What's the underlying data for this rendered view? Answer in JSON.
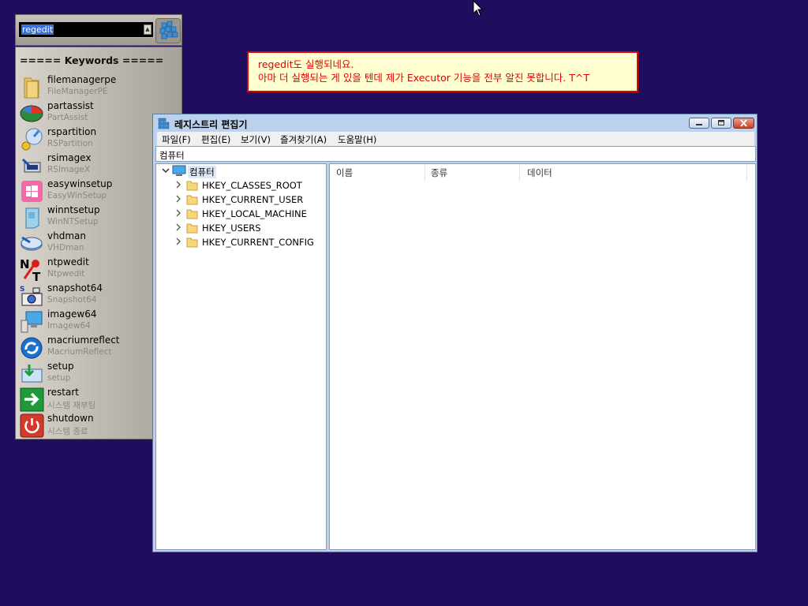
{
  "launcher": {
    "search_value": "regedit",
    "header": "===== Keywords =====",
    "items": [
      {
        "name": "filemanagerpe",
        "sub": "FileManagerPE",
        "icon": "folder-icon"
      },
      {
        "name": "partassist",
        "sub": "PartAssist",
        "icon": "partition-pie-icon"
      },
      {
        "name": "rspartition",
        "sub": "RSPartition",
        "icon": "disk-wizard-icon"
      },
      {
        "name": "rsimagex",
        "sub": "RSImageX",
        "icon": "image-backup-icon"
      },
      {
        "name": "easywinsetup",
        "sub": "EasyWinSetup",
        "icon": "windows-logo-icon"
      },
      {
        "name": "winntsetup",
        "sub": "WinNTSetup",
        "icon": "setup-box-icon"
      },
      {
        "name": "vhdman",
        "sub": "VHDman",
        "icon": "vhd-disk-icon"
      },
      {
        "name": "ntpwedit",
        "sub": "Ntpwedit",
        "icon": "nt-key-icon"
      },
      {
        "name": "snapshot64",
        "sub": "Snapshot64",
        "icon": "camera-icon"
      },
      {
        "name": "imagew64",
        "sub": "Imagew64",
        "icon": "monitor-icon"
      },
      {
        "name": "macriumreflect",
        "sub": "MacriumReflect",
        "icon": "macrium-icon"
      },
      {
        "name": "setup",
        "sub": "setup",
        "icon": "setup-arrow-icon"
      },
      {
        "name": "restart",
        "sub": "시스템 재부팅",
        "icon": "restart-arrow-icon"
      },
      {
        "name": "shutdown",
        "sub": "시스템 종료",
        "icon": "power-icon"
      }
    ]
  },
  "notice": {
    "line1": "regedit도 실행되네요.",
    "line2": "아마 더 실행되는 게 있을 텐데 제가 Executor 기능을 전부 알진 못합니다. T^T"
  },
  "regedit": {
    "title": "레지스트리 편집기",
    "menu": [
      "파일(F)",
      "편집(E)",
      "보기(V)",
      "즐겨찾기(A)",
      "도움말(H)"
    ],
    "address": "컴퓨터",
    "tree_root": "컴퓨터",
    "hives": [
      "HKEY_CLASSES_ROOT",
      "HKEY_CURRENT_USER",
      "HKEY_LOCAL_MACHINE",
      "HKEY_USERS",
      "HKEY_CURRENT_CONFIG"
    ],
    "columns": [
      "이름",
      "종류",
      "데이터"
    ]
  },
  "colors": {
    "desktop": "#210d5d",
    "notice_text": "#e00000",
    "notice_bg": "#ffffd2",
    "window_frame": "#bcd2ec"
  }
}
